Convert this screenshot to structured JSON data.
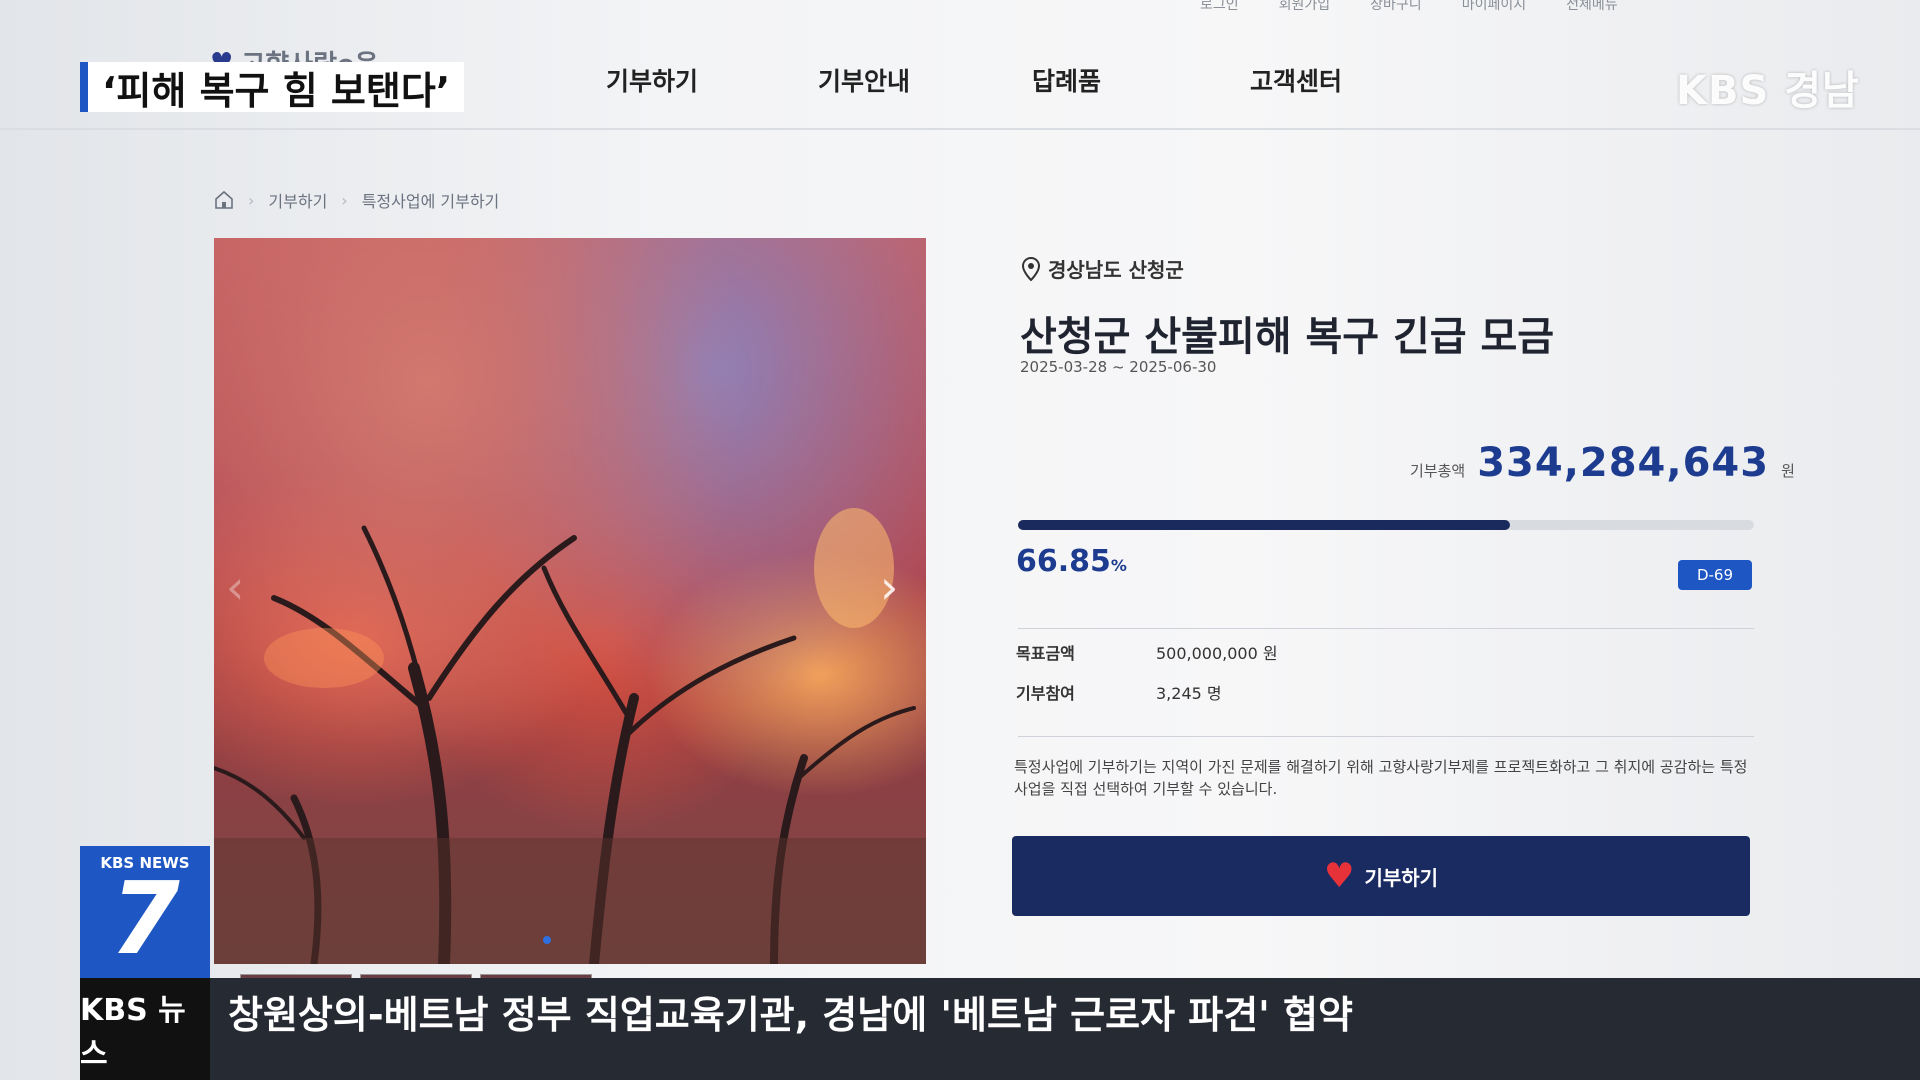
{
  "site": {
    "logo_text": "고향사랑e음",
    "utility": [
      "로그인",
      "회원가입",
      "장바구니",
      "마이페이지",
      "전체메뉴"
    ],
    "nav": [
      "기부하기",
      "기부안내",
      "답례품",
      "고객센터"
    ]
  },
  "breadcrumb": [
    "기부하기",
    "특정사업에 기부하기"
  ],
  "project": {
    "location": "경상남도 산청군",
    "title": "산청군 산불피해 복구 긴급 모금",
    "period": "2025-03-28 ~ 2025-06-30",
    "total_label": "기부총액",
    "total_value": "334,284,643",
    "total_unit": "원",
    "progress_percent": 66.85,
    "percent_text": "66.85",
    "percent_unit": "%",
    "dday": "D-69",
    "goal_label": "목표금액",
    "goal_value": "500,000,000 원",
    "count_label": "기부참여",
    "count_value": "3,245 명",
    "description": "특정사업에 기부하기는 지역이 가진 문제를 해결하기 위해 고향사랑기부제를 프로젝트화하고 그 취지에 공감하는 특정사업을 직접 선택하여 기부할 수 있습니다.",
    "donate_label": "기부하기"
  },
  "broadcast": {
    "caption": "‘피해 복구 힘 보탠다’",
    "channel_logo": "KBS 경남",
    "news_label": "KBS NEWS",
    "news_number": "7",
    "footer_label": "KBS 뉴스",
    "ticker": "창원상의-베트남 정부 직업교육기관, 경남에 '베트남 근로자 파견' 협약"
  },
  "colors": {
    "accent": "#1d3c8f",
    "button": "#1a2b62",
    "dday_badge": "#1e56c4",
    "broadcast_blue": "#1e56c4"
  }
}
